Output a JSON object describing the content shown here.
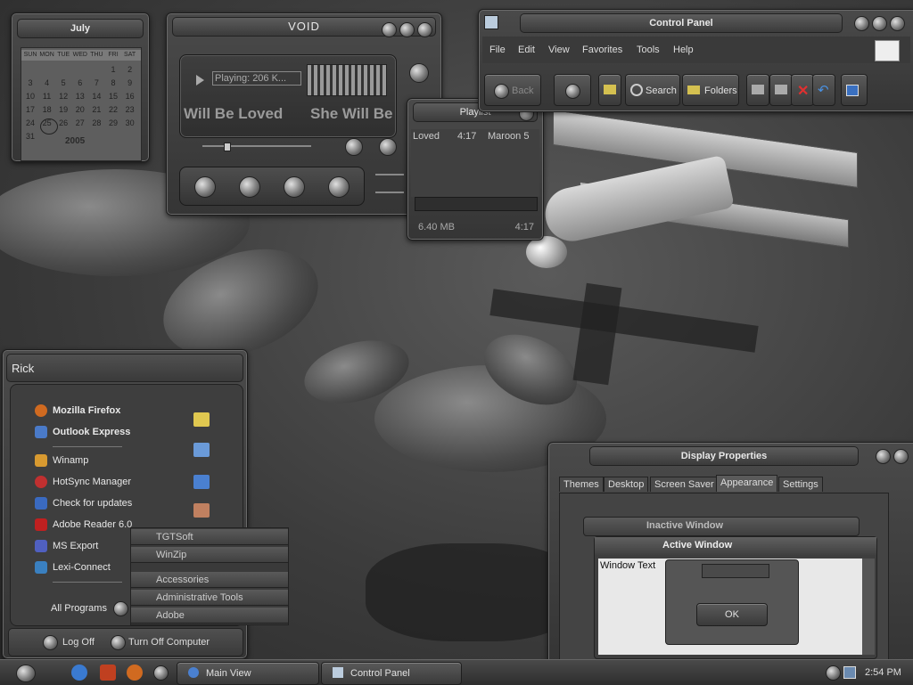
{
  "calendar": {
    "month": "July",
    "weekdays": [
      "SUN",
      "MON",
      "TUE",
      "WED",
      "THU",
      "FRI",
      "SAT"
    ],
    "rows": [
      [
        "",
        "",
        "",
        "",
        "",
        "1",
        "2"
      ],
      [
        "3",
        "4",
        "5",
        "6",
        "7",
        "8",
        "9"
      ],
      [
        "10",
        "11",
        "12",
        "13",
        "14",
        "15",
        "16"
      ],
      [
        "17",
        "18",
        "19",
        "20",
        "21",
        "22",
        "23"
      ],
      [
        "24",
        "25",
        "26",
        "27",
        "28",
        "29",
        "30"
      ],
      [
        "31",
        "",
        "",
        "",
        "",
        "",
        ""
      ]
    ],
    "year": "2005"
  },
  "player": {
    "title": "VOID",
    "status": "Playing: 206 K...",
    "song_left": "Will Be Loved",
    "song_right": "She Will Be"
  },
  "playlist": {
    "title": "Playlist",
    "row_song": "Loved",
    "row_time": "4:17",
    "row_artist": "Maroon 5",
    "size": "6.40 MB",
    "total": "4:17"
  },
  "control_panel": {
    "title": "Control Panel",
    "menu": [
      "File",
      "Edit",
      "View",
      "Favorites",
      "Tools",
      "Help"
    ],
    "back": "Back",
    "search": "Search",
    "folders": "Folders"
  },
  "start_menu": {
    "user": "Rick",
    "pinned": [
      "Mozilla Firefox",
      "Outlook Express"
    ],
    "recent": [
      "Winamp",
      "HotSync Manager",
      "Check for updates",
      "Adobe Reader 6.0",
      "MS Export",
      "Lexi-Connect"
    ],
    "all_programs": "All Programs",
    "log_off": "Log Off",
    "turn_off": "Turn Off Computer",
    "submenu": [
      "TGTSoft",
      "WinZip",
      "Accessories",
      "Administrative Tools",
      "Adobe"
    ]
  },
  "display_properties": {
    "title": "Display Properties",
    "tabs": [
      "Themes",
      "Desktop",
      "Screen Saver",
      "Appearance",
      "Settings"
    ],
    "inactive": "Inactive Window",
    "active": "Active Window",
    "window_text": "Window Text",
    "msg_box_title": "",
    "ok": "OK"
  },
  "taskbar": {
    "tasks": [
      "Main View",
      "Control Panel"
    ],
    "clock": "2:54 PM"
  }
}
